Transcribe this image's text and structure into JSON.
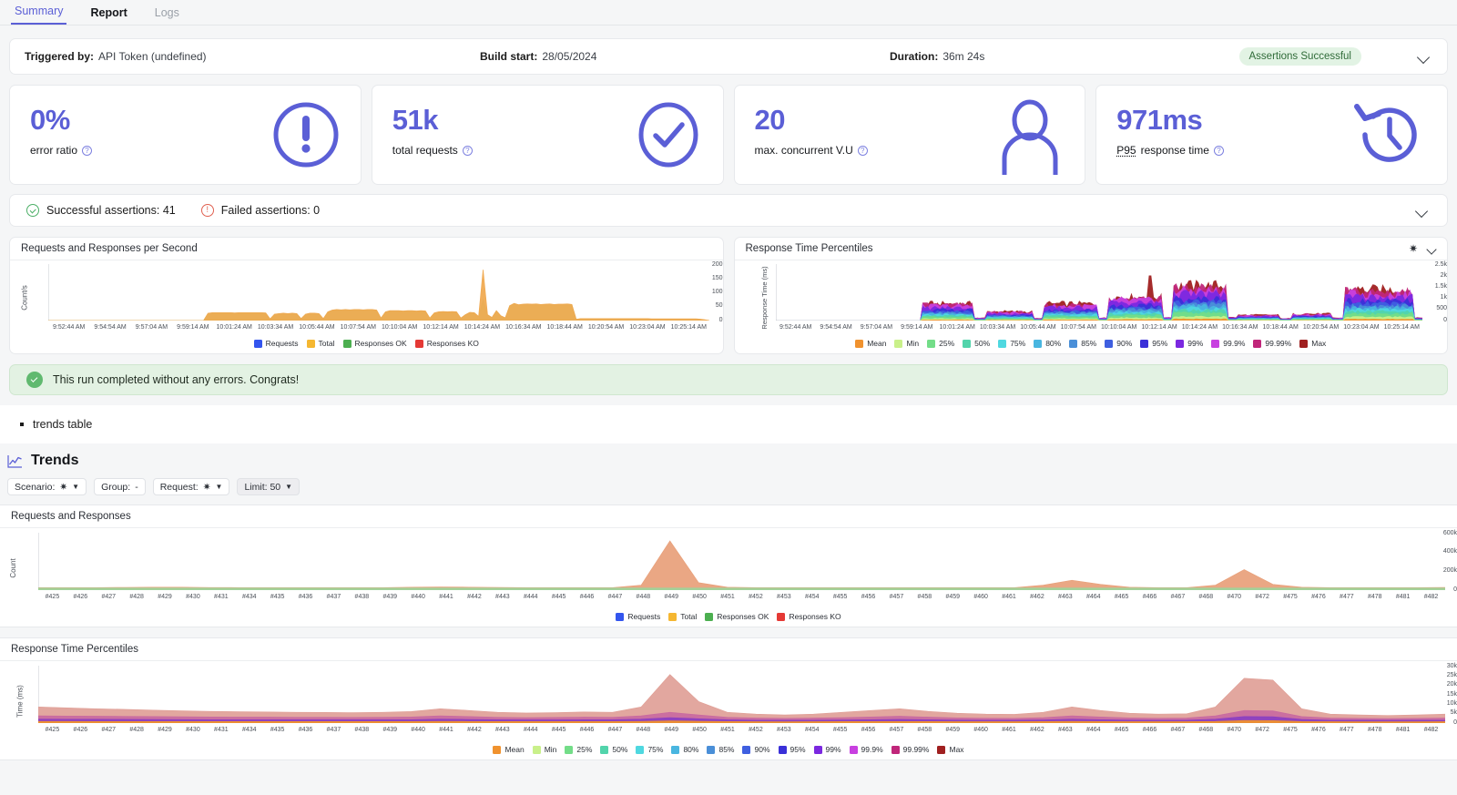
{
  "tabs": [
    {
      "label": "Summary",
      "state": "active"
    },
    {
      "label": "Report",
      "state": "normal"
    },
    {
      "label": "Logs",
      "state": "muted"
    }
  ],
  "info": {
    "triggered_label": "Triggered by:",
    "triggered_value": "API Token (undefined)",
    "build_label": "Build start:",
    "build_value": "28/05/2024",
    "duration_label": "Duration:",
    "duration_value": "36m 24s",
    "badge": "Assertions Successful",
    "chevron": "chevron-down-icon"
  },
  "kpis": [
    {
      "value": "0%",
      "label": "error ratio",
      "icon": "exclamation-circle-icon",
      "help": "?"
    },
    {
      "value": "51k",
      "label": "total requests",
      "icon": "check-circle-icon",
      "help": "?"
    },
    {
      "value": "20",
      "label": "max. concurrent V.U",
      "icon": "user-icon",
      "help": "?"
    },
    {
      "value": "971ms",
      "label_prefix": "P95",
      "label": "response time",
      "icon": "clock-rewind-icon",
      "help": "?"
    }
  ],
  "assertions": {
    "successful": "Successful assertions: 41",
    "failed": "Failed assertions: 0"
  },
  "banner": {
    "text": "This run completed without any errors. Congrats!"
  },
  "bullet": {
    "text": "trends table"
  },
  "trends": {
    "title": "Trends",
    "filters": [
      {
        "label": "Scenario:",
        "value": "✷",
        "caret": true,
        "selected": false
      },
      {
        "label": "Group:",
        "value": "-",
        "caret": false,
        "selected": false
      },
      {
        "label": "Request:",
        "value": "✷",
        "caret": true,
        "selected": false
      },
      {
        "label": "Limit: 50",
        "value": "",
        "caret": true,
        "selected": true
      }
    ]
  },
  "chart_data": [
    {
      "type": "area",
      "title": "Requests and Responses per Second",
      "xlabel": "",
      "ylabel": "Count/s",
      "ylim": [
        0,
        200
      ],
      "yticks": [
        "200",
        "150",
        "100",
        "50",
        "0"
      ],
      "xticks": [
        "9:52:44 AM",
        "9:54:54 AM",
        "9:57:04 AM",
        "9:59:14 AM",
        "10:01:24 AM",
        "10:03:34 AM",
        "10:05:44 AM",
        "10:07:54 AM",
        "10:10:04 AM",
        "10:12:14 AM",
        "10:14:24 AM",
        "10:16:34 AM",
        "10:18:44 AM",
        "10:20:54 AM",
        "10:23:04 AM",
        "10:25:14 AM"
      ],
      "legend": [
        {
          "name": "Requests",
          "color": "#3355ee"
        },
        {
          "name": "Total",
          "color": "#f5b731"
        },
        {
          "name": "Responses OK",
          "color": "#4caf50"
        },
        {
          "name": "Responses KO",
          "color": "#e53935"
        }
      ],
      "series": [
        {
          "name": "Responses OK",
          "color": "#a8d9a0",
          "values": [
            0,
            0,
            0,
            0,
            0,
            0,
            0,
            0,
            0,
            0,
            0,
            0,
            0,
            0,
            0,
            0,
            0,
            0,
            0,
            0,
            0,
            0,
            0,
            0,
            0,
            0,
            0,
            0,
            0,
            0,
            0,
            0,
            0,
            0,
            0,
            0,
            25,
            27,
            27,
            27,
            27,
            27,
            26,
            27,
            27,
            27,
            27,
            27,
            27,
            26,
            5,
            22,
            24,
            25,
            24,
            25,
            24,
            6,
            22,
            25,
            25,
            24,
            6,
            30,
            36,
            38,
            37,
            38,
            37,
            38,
            38,
            37,
            38,
            38,
            36,
            8,
            30,
            34,
            34,
            34,
            33,
            34,
            34,
            33,
            34,
            33,
            8,
            26,
            30,
            31,
            30,
            31,
            30,
            8,
            20,
            28,
            27,
            14,
            75,
            20,
            10,
            34,
            16,
            9,
            52,
            60,
            55,
            57,
            58,
            57,
            58,
            56,
            57,
            58,
            56,
            57,
            57,
            58,
            56,
            4,
            6,
            6,
            6,
            6,
            6,
            6,
            6,
            6,
            6,
            6,
            6,
            6,
            6,
            6,
            6,
            6,
            5,
            5,
            5,
            5,
            5,
            5,
            5,
            5,
            5,
            5,
            5,
            4,
            2,
            0
          ]
        },
        {
          "name": "Total",
          "color": "#f0a84e",
          "values": [
            0,
            0,
            0,
            0,
            0,
            0,
            0,
            0,
            0,
            0,
            0,
            0,
            0,
            0,
            0,
            0,
            0,
            0,
            0,
            0,
            0,
            0,
            0,
            0,
            0,
            0,
            0,
            0,
            0,
            0,
            0,
            0,
            0,
            0,
            0,
            0,
            26,
            28,
            28,
            28,
            28,
            28,
            27,
            28,
            28,
            28,
            28,
            28,
            28,
            27,
            6,
            23,
            25,
            26,
            25,
            26,
            25,
            7,
            23,
            26,
            26,
            25,
            7,
            31,
            37,
            39,
            38,
            39,
            38,
            39,
            39,
            38,
            39,
            39,
            37,
            9,
            31,
            35,
            35,
            35,
            34,
            35,
            35,
            34,
            35,
            34,
            9,
            27,
            31,
            32,
            31,
            32,
            31,
            9,
            21,
            29,
            28,
            15,
            180,
            21,
            11,
            35,
            17,
            10,
            53,
            61,
            56,
            58,
            59,
            58,
            59,
            57,
            58,
            59,
            57,
            58,
            58,
            59,
            57,
            5,
            7,
            7,
            7,
            7,
            7,
            7,
            7,
            7,
            7,
            7,
            7,
            7,
            7,
            7,
            7,
            7,
            6,
            6,
            6,
            6,
            6,
            6,
            6,
            6,
            6,
            6,
            6,
            5,
            3,
            0
          ]
        }
      ]
    },
    {
      "type": "area",
      "title": "Response Time Percentiles",
      "xlabel": "",
      "ylabel": "Response Time (ms)",
      "ylim": [
        0,
        2500
      ],
      "yticks": [
        "2.5k",
        "2k",
        "1.5k",
        "1k",
        "500",
        "0"
      ],
      "xticks": [
        "9:52:44 AM",
        "9:54:54 AM",
        "9:57:04 AM",
        "9:59:14 AM",
        "10:01:24 AM",
        "10:03:34 AM",
        "10:05:44 AM",
        "10:07:54 AM",
        "10:10:04 AM",
        "10:12:14 AM",
        "10:14:24 AM",
        "10:16:34 AM",
        "10:18:44 AM",
        "10:20:54 AM",
        "10:23:04 AM",
        "10:25:14 AM"
      ],
      "tools": [
        "asterisk-icon",
        "chevron-down-icon"
      ],
      "legend": [
        {
          "name": "Mean",
          "color": "#f0922e"
        },
        {
          "name": "Min",
          "color": "#c9f08a"
        },
        {
          "name": "25%",
          "color": "#73dd88"
        },
        {
          "name": "50%",
          "color": "#52d4ab"
        },
        {
          "name": "75%",
          "color": "#4fd8e0"
        },
        {
          "name": "80%",
          "color": "#49b6e0"
        },
        {
          "name": "85%",
          "color": "#4a8fd8"
        },
        {
          "name": "90%",
          "color": "#3f5fe0"
        },
        {
          "name": "95%",
          "color": "#3a30d8"
        },
        {
          "name": "99%",
          "color": "#7b28e0"
        },
        {
          "name": "99.9%",
          "color": "#c840e0"
        },
        {
          "name": "99.99%",
          "color": "#c0267a"
        },
        {
          "name": "Max",
          "color": "#a02020"
        }
      ]
    },
    {
      "type": "area",
      "title": "Requests and Responses",
      "xlabel": "",
      "ylabel": "Count",
      "ylim": [
        0,
        700000
      ],
      "yticks": [
        "600k",
        "400k",
        "200k",
        "0"
      ],
      "xticks": [
        "#425",
        "#426",
        "#427",
        "#428",
        "#429",
        "#430",
        "#431",
        "#434",
        "#435",
        "#436",
        "#437",
        "#438",
        "#439",
        "#440",
        "#441",
        "#442",
        "#443",
        "#444",
        "#445",
        "#446",
        "#447",
        "#448",
        "#449",
        "#450",
        "#451",
        "#452",
        "#453",
        "#454",
        "#455",
        "#456",
        "#457",
        "#458",
        "#459",
        "#460",
        "#461",
        "#462",
        "#463",
        "#464",
        "#465",
        "#466",
        "#467",
        "#468",
        "#470",
        "#472",
        "#475",
        "#476",
        "#477",
        "#478",
        "#481",
        "#482"
      ],
      "legend": [
        {
          "name": "Requests",
          "color": "#3355ee"
        },
        {
          "name": "Total",
          "color": "#f5b731"
        },
        {
          "name": "Responses OK",
          "color": "#4caf50"
        },
        {
          "name": "Responses KO",
          "color": "#e53935"
        }
      ],
      "series": [
        {
          "name": "Total",
          "color": "#e8a07a",
          "values": [
            30000,
            30000,
            30000,
            32000,
            36000,
            34000,
            31000,
            30000,
            30000,
            30000,
            30000,
            30000,
            30000,
            34000,
            38000,
            36000,
            32000,
            30000,
            30000,
            30000,
            30000,
            60000,
            600000,
            90000,
            34000,
            30000,
            30000,
            30000,
            30000,
            30000,
            30000,
            30000,
            30000,
            30000,
            30000,
            60000,
            120000,
            70000,
            34000,
            30000,
            30000,
            60000,
            250000,
            70000,
            34000,
            30000,
            30000,
            30000,
            30000,
            32000
          ]
        },
        {
          "name": "Responses OK",
          "color": "#9ed49a",
          "values": [
            26000,
            26000,
            26000,
            26000,
            26000,
            26000,
            26000,
            26000,
            26000,
            26000,
            26000,
            26000,
            26000,
            26000,
            26000,
            26000,
            26000,
            26000,
            26000,
            26000,
            26000,
            26000,
            26000,
            26000,
            26000,
            26000,
            26000,
            26000,
            26000,
            26000,
            26000,
            26000,
            26000,
            26000,
            26000,
            26000,
            26000,
            26000,
            26000,
            26000,
            26000,
            26000,
            26000,
            26000,
            26000,
            26000,
            26000,
            26000,
            26000,
            26000
          ]
        }
      ]
    },
    {
      "type": "area",
      "title": "Response Time Percentiles",
      "xlabel": "",
      "ylabel": "Time (ms)",
      "ylim": [
        0,
        32000
      ],
      "yticks": [
        "30k",
        "25k",
        "20k",
        "15k",
        "10k",
        "5k",
        "0"
      ],
      "xticks": [
        "#425",
        "#426",
        "#427",
        "#428",
        "#429",
        "#430",
        "#431",
        "#434",
        "#435",
        "#436",
        "#437",
        "#438",
        "#439",
        "#440",
        "#441",
        "#442",
        "#443",
        "#444",
        "#445",
        "#446",
        "#447",
        "#448",
        "#449",
        "#450",
        "#451",
        "#452",
        "#453",
        "#454",
        "#455",
        "#456",
        "#457",
        "#458",
        "#459",
        "#460",
        "#461",
        "#462",
        "#463",
        "#464",
        "#465",
        "#466",
        "#467",
        "#468",
        "#470",
        "#472",
        "#475",
        "#476",
        "#477",
        "#478",
        "#481",
        "#482"
      ],
      "legend": [
        {
          "name": "Mean",
          "color": "#f0922e"
        },
        {
          "name": "Min",
          "color": "#c9f08a"
        },
        {
          "name": "25%",
          "color": "#73dd88"
        },
        {
          "name": "50%",
          "color": "#52d4ab"
        },
        {
          "name": "75%",
          "color": "#4fd8e0"
        },
        {
          "name": "80%",
          "color": "#49b6e0"
        },
        {
          "name": "85%",
          "color": "#4a8fd8"
        },
        {
          "name": "90%",
          "color": "#3f5fe0"
        },
        {
          "name": "95%",
          "color": "#3a30d8"
        },
        {
          "name": "99%",
          "color": "#7b28e0"
        },
        {
          "name": "99.9%",
          "color": "#c840e0"
        },
        {
          "name": "99.99%",
          "color": "#c0267a"
        },
        {
          "name": "Max",
          "color": "#a02020"
        }
      ],
      "series": [
        {
          "name": "Max",
          "color": "#e0a097",
          "values": [
            9000,
            8500,
            8000,
            7600,
            7200,
            6800,
            6500,
            6300,
            6200,
            6000,
            5900,
            5800,
            6000,
            6400,
            8000,
            7000,
            6000,
            5600,
            5800,
            6200,
            6000,
            9000,
            27000,
            12000,
            6000,
            5000,
            4500,
            5000,
            6000,
            7000,
            8000,
            6500,
            5500,
            5000,
            4800,
            6000,
            9000,
            7000,
            5500,
            5000,
            5200,
            9000,
            25000,
            24000,
            8000,
            5000,
            4500,
            4200,
            4500,
            5000
          ]
        },
        {
          "name": "99.99%",
          "color": "#c96aa0",
          "values": [
            4000,
            3900,
            3800,
            3700,
            3600,
            3500,
            3400,
            3300,
            3300,
            3200,
            3200,
            3100,
            3200,
            3400,
            4000,
            3600,
            3200,
            3000,
            3100,
            3300,
            3200,
            4000,
            6000,
            4500,
            3200,
            2800,
            2600,
            2800,
            3000,
            3400,
            3800,
            3300,
            2900,
            2700,
            2600,
            3000,
            4000,
            3400,
            2900,
            2700,
            2800,
            4000,
            7000,
            6800,
            3600,
            2800,
            2600,
            2500,
            2600,
            2800
          ]
        },
        {
          "name": "99%",
          "color": "#8b3fc0",
          "values": [
            2200,
            2150,
            2100,
            2050,
            2000,
            1950,
            1900,
            1880,
            1860,
            1840,
            1830,
            1810,
            1830,
            1900,
            2200,
            2000,
            1820,
            1760,
            1790,
            1850,
            1820,
            2200,
            3000,
            2400,
            1820,
            1650,
            1560,
            1650,
            1730,
            1880,
            2020,
            1830,
            1700,
            1620,
            1580,
            1730,
            2200,
            1880,
            1700,
            1620,
            1650,
            2200,
            3600,
            3500,
            2030,
            1650,
            1560,
            1520,
            1560,
            1650
          ]
        },
        {
          "name": "Mean",
          "color": "#f0922e",
          "values": [
            900,
            890,
            880,
            870,
            860,
            850,
            840,
            835,
            830,
            825,
            822,
            818,
            822,
            840,
            900,
            860,
            820,
            800,
            810,
            830,
            820,
            900,
            1200,
            980,
            820,
            760,
            730,
            760,
            790,
            840,
            880,
            820,
            780,
            750,
            740,
            790,
            900,
            840,
            780,
            750,
            760,
            900,
            1400,
            1380,
            860,
            760,
            730,
            715,
            730,
            760
          ]
        }
      ]
    }
  ]
}
